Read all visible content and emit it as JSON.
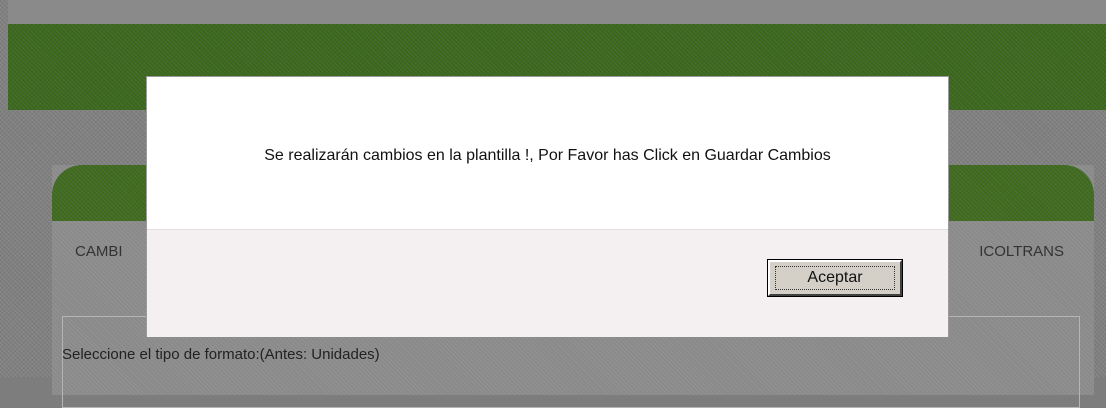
{
  "background_page": {
    "tab_left_label": "CAMBI",
    "tab_right_label": "ICOLTRANS",
    "format_label": "Seleccione el tipo de formato:(Antes: Unidades)"
  },
  "dialog": {
    "message": "Se realizarán cambios en la plantilla !, Por Favor has Click en Guardar Cambios",
    "ok_label": "Aceptar"
  },
  "colors": {
    "header_green": "#3a6a1a",
    "overlay_gray": "#808080",
    "dialog_footer": "#f4f0f2",
    "button_face": "#d4d0c8"
  }
}
